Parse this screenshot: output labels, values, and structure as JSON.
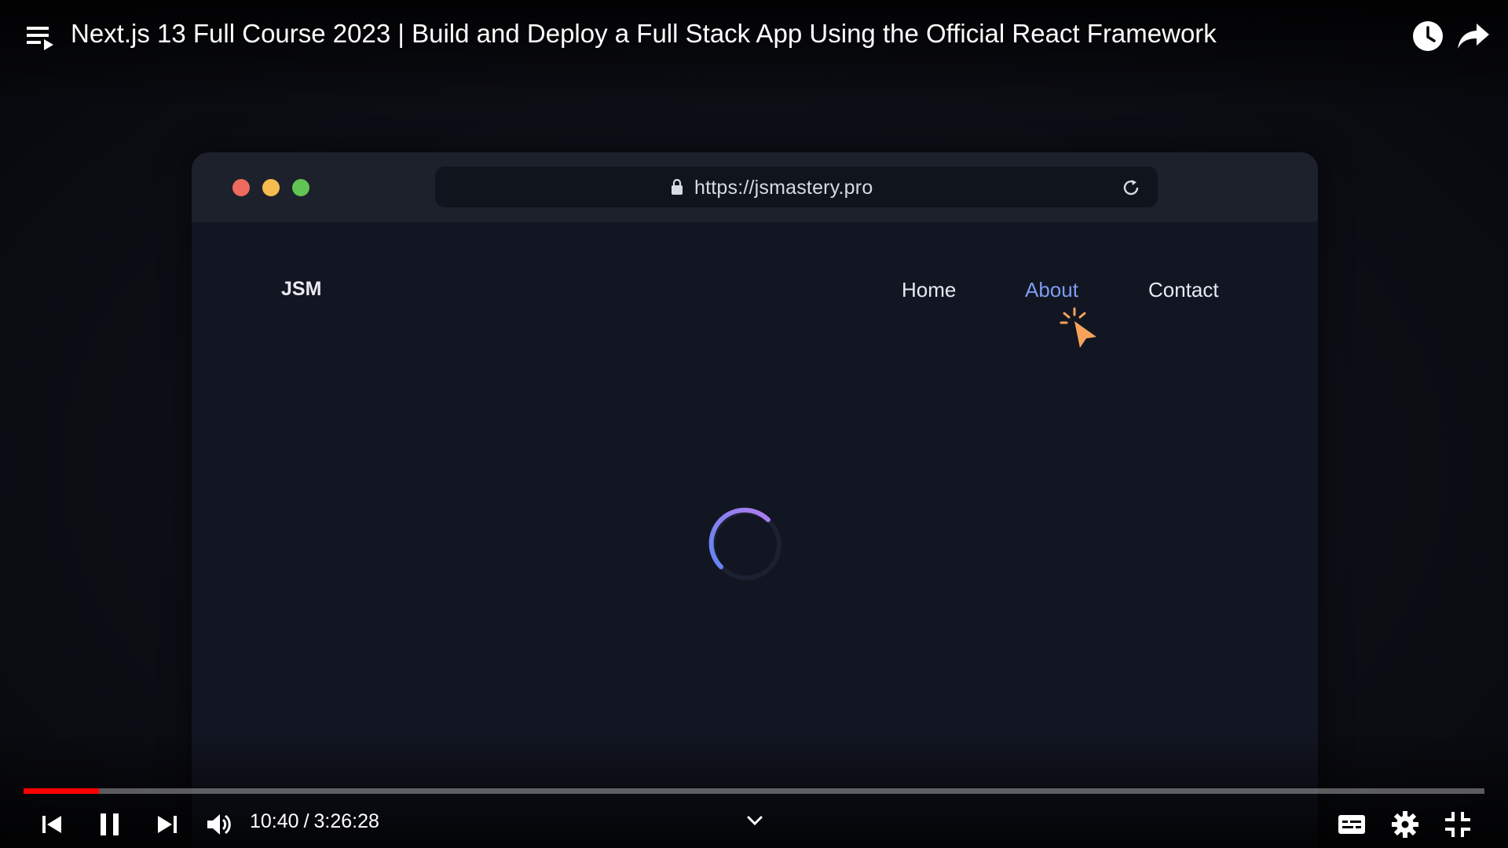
{
  "video": {
    "title": "Next.js 13 Full Course 2023 | Build and Deploy a Full Stack App Using the Official React Framework"
  },
  "browser_mock": {
    "url": "https://jsmastery.pro",
    "logo": "JSM",
    "nav": [
      {
        "label": "Home"
      },
      {
        "label": "About"
      },
      {
        "label": "Contact"
      }
    ],
    "active_nav": "About",
    "dot_colors": [
      "#ee6a5f",
      "#f5bd4f",
      "#61c454"
    ]
  },
  "player": {
    "current_time": "10:40",
    "separator": "/",
    "duration": "3:26:28",
    "progress_fraction": 0.0516,
    "progress_color": "#ff0000"
  },
  "icons": {
    "top_left": "playlist-icon",
    "top_right": [
      "watch-later-icon",
      "share-icon"
    ],
    "controls_left": [
      "previous-icon",
      "pause-icon",
      "next-icon",
      "volume-icon"
    ],
    "controls_center": "chevron-down-icon",
    "controls_right": [
      "subtitles-icon",
      "settings-icon",
      "exit-fullscreen-icon"
    ]
  }
}
